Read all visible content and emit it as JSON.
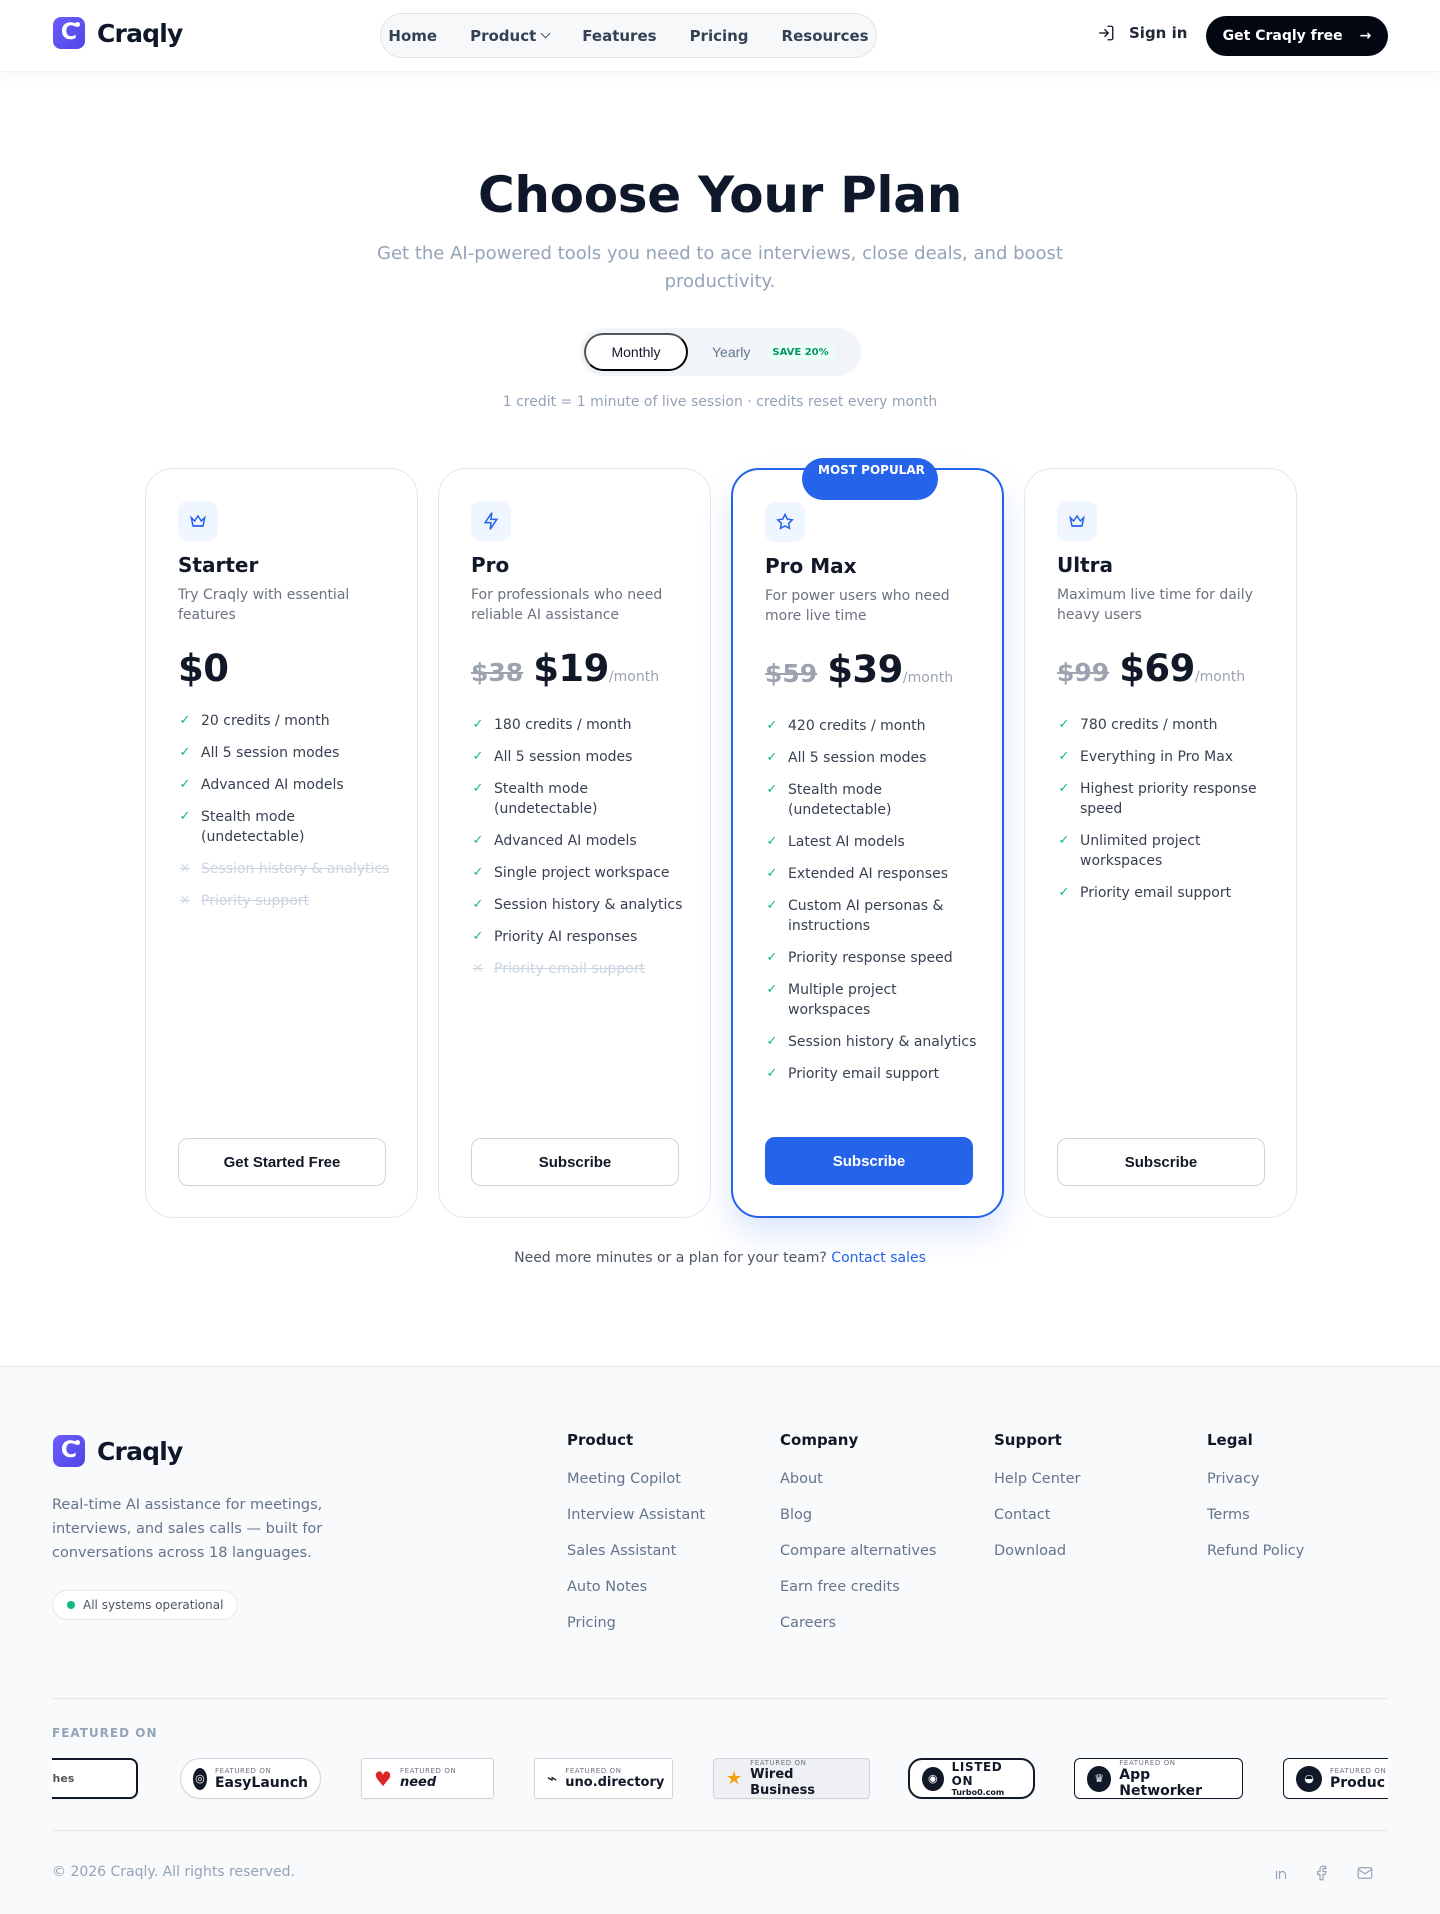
{
  "brand": {
    "name": "Craqly"
  },
  "nav": {
    "items": [
      {
        "label": "Home"
      },
      {
        "label": "Product"
      },
      {
        "label": "Features"
      },
      {
        "label": "Pricing"
      },
      {
        "label": "Resources"
      }
    ],
    "signin": "Sign in",
    "cta": "Get Craqly free"
  },
  "hero": {
    "title": "Choose Your Plan",
    "subtitle": "Get the AI-powered tools you need to ace interviews, close deals, and boost productivity."
  },
  "billing": {
    "monthly": "Monthly",
    "yearly": "Yearly",
    "save": "SAVE 20%",
    "selected": "Monthly",
    "note": "1 credit = 1 minute of live session · credits reset every month"
  },
  "plans": [
    {
      "name": "Starter",
      "icon": "crown-icon",
      "description": "Try Craqly with essential features",
      "old_price": "",
      "price": "$0",
      "period": "",
      "button": "Get Started Free",
      "popular": false,
      "features": [
        {
          "text": "20 credits / month",
          "included": true
        },
        {
          "text": "All 5 session modes",
          "included": true
        },
        {
          "text": "Advanced AI models",
          "included": true
        },
        {
          "text": "Stealth mode (undetectable)",
          "included": true
        },
        {
          "text": "Session history & analytics",
          "included": false
        },
        {
          "text": "Priority support",
          "included": false
        }
      ]
    },
    {
      "name": "Pro",
      "icon": "lightning-icon",
      "description": "For professionals who need reliable AI assistance",
      "old_price": "$38",
      "price": "$19",
      "period": "/month",
      "button": "Subscribe",
      "popular": false,
      "features": [
        {
          "text": "180 credits / month",
          "included": true
        },
        {
          "text": "All 5 session modes",
          "included": true
        },
        {
          "text": "Stealth mode (undetectable)",
          "included": true
        },
        {
          "text": "Advanced AI models",
          "included": true
        },
        {
          "text": "Single project workspace",
          "included": true
        },
        {
          "text": "Session history & analytics",
          "included": true
        },
        {
          "text": "Priority AI responses",
          "included": true
        },
        {
          "text": "Priority email support",
          "included": false
        }
      ]
    },
    {
      "name": "Pro Max",
      "icon": "star-icon",
      "description": "For power users who need more live time",
      "old_price": "$59",
      "price": "$39",
      "period": "/month",
      "button": "Subscribe",
      "popular": true,
      "badge": "MOST POPULAR",
      "features": [
        {
          "text": "420 credits / month",
          "included": true
        },
        {
          "text": "All 5 session modes",
          "included": true
        },
        {
          "text": "Stealth mode (undetectable)",
          "included": true
        },
        {
          "text": "Latest AI models",
          "included": true
        },
        {
          "text": "Extended AI responses",
          "included": true
        },
        {
          "text": "Custom AI personas & instructions",
          "included": true
        },
        {
          "text": "Priority response speed",
          "included": true
        },
        {
          "text": "Multiple project workspaces",
          "included": true
        },
        {
          "text": "Session history & analytics",
          "included": true
        },
        {
          "text": "Priority email support",
          "included": true
        }
      ]
    },
    {
      "name": "Ultra",
      "icon": "crown-icon",
      "description": "Maximum live time for daily heavy users",
      "old_price": "$99",
      "price": "$69",
      "period": "/month",
      "button": "Subscribe",
      "popular": false,
      "features": [
        {
          "text": "780 credits / month",
          "included": true
        },
        {
          "text": "Everything in Pro Max",
          "included": true
        },
        {
          "text": "Highest priority response speed",
          "included": true
        },
        {
          "text": "Unlimited project workspaces",
          "included": true
        },
        {
          "text": "Priority email support",
          "included": true
        }
      ]
    }
  ],
  "contact": {
    "text": "Need more minutes or a plan for your team?",
    "link": "Contact sales"
  },
  "footer": {
    "description": "Real-time AI assistance for meetings, interviews, and sales calls — built for conversations across 18 languages.",
    "status": "All systems operational",
    "columns": [
      {
        "title": "Product",
        "links": [
          "Meeting Copilot",
          "Interview Assistant",
          "Sales Assistant",
          "Auto Notes",
          "Pricing"
        ]
      },
      {
        "title": "Company",
        "links": [
          "About",
          "Blog",
          "Compare alternatives",
          "Earn free credits",
          "Careers"
        ]
      },
      {
        "title": "Support",
        "links": [
          "Help Center",
          "Contact",
          "Download"
        ]
      },
      {
        "title": "Legal",
        "links": [
          "Privacy",
          "Terms",
          "Refund Policy"
        ]
      }
    ],
    "featured_label": "FEATURED ON",
    "badges": [
      {
        "small": "",
        "big": "ches",
        "icon": ""
      },
      {
        "small": "FEATURED ON",
        "big": "EasyLaunch",
        "icon": "◎"
      },
      {
        "small": "FEATURED ON",
        "big": "need",
        "icon": "♥"
      },
      {
        "small": "FEATURED ON",
        "big": "uno.directory",
        "icon": "⌁"
      },
      {
        "small": "FEATURED ON",
        "big": "Wired Business",
        "icon": "★"
      },
      {
        "small": "LISTED ON",
        "big": "Turbo0.com",
        "icon": "◉"
      },
      {
        "small": "FEATURED ON",
        "big": "App Networker",
        "icon": "♛"
      },
      {
        "small": "FEATURED ON",
        "big": "Produc",
        "icon": "◒"
      }
    ],
    "copyright": "© 2026 Craqly. All rights reserved.",
    "social_icons": [
      "linkedin-icon",
      "facebook-icon",
      "mail-icon"
    ]
  }
}
